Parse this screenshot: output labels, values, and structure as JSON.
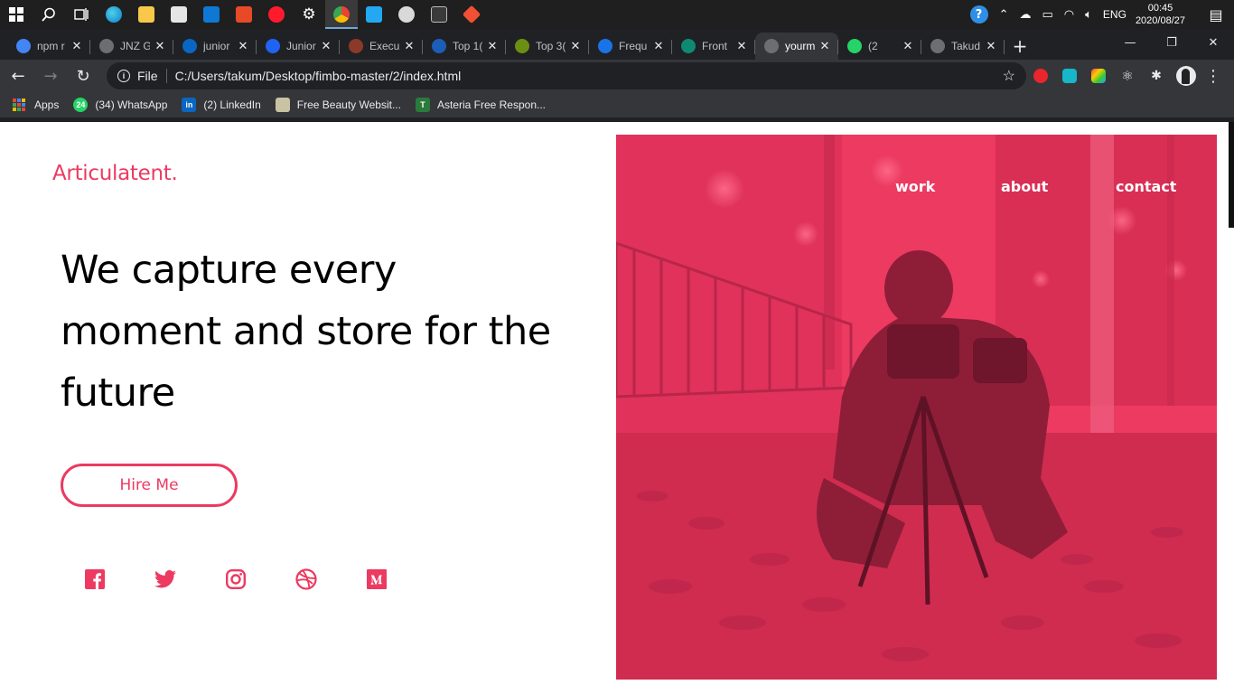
{
  "taskbar": {
    "clock_time": "00:45",
    "clock_date": "2020/08/27",
    "language": "ENG",
    "apps": [
      "windows-start",
      "search",
      "task-view",
      "edge",
      "file-explorer",
      "store",
      "mail",
      "office",
      "opera",
      "settings",
      "chrome",
      "vscode",
      "media",
      "terminal",
      "git"
    ]
  },
  "tabs": [
    {
      "label": "npm r",
      "favicon": "google-icon",
      "color": "#4285f4",
      "active": false
    },
    {
      "label": "JNZ G",
      "favicon": "globe-icon",
      "color": "#6b6e73",
      "active": false
    },
    {
      "label": "junior",
      "favicon": "linkedin-icon",
      "color": "#0a66c2",
      "active": false
    },
    {
      "label": "Junior",
      "favicon": "indeed-icon",
      "color": "#2164f3",
      "active": false
    },
    {
      "label": "Execu",
      "favicon": "x-icon",
      "color": "#8b3a2a",
      "active": false
    },
    {
      "label": "Top 1(",
      "favicon": "e-icon",
      "color": "#1c5db8",
      "active": false
    },
    {
      "label": "Top 3(",
      "favicon": "a-icon",
      "color": "#6a8f12",
      "active": false
    },
    {
      "label": "Frequ",
      "favicon": "ssd-icon",
      "color": "#1a73e8",
      "active": false
    },
    {
      "label": "Front",
      "favicon": "w-icon",
      "color": "#0e8a72",
      "active": false
    },
    {
      "label": "yourm",
      "favicon": "globe-icon",
      "color": "#6b6e73",
      "active": true
    },
    {
      "label": "(2",
      "favicon": "whatsapp-icon",
      "color": "#25d366",
      "active": false
    },
    {
      "label": "Takud",
      "favicon": "globe-icon",
      "color": "#6b6e73",
      "active": false
    }
  ],
  "addressbar": {
    "scheme_label": "File",
    "url": "C:/Users/takum/Desktop/fimbo-master/2/index.html"
  },
  "bookmarks": [
    {
      "label": "Apps",
      "icon": "apps-grid-icon"
    },
    {
      "label": "(34) WhatsApp",
      "icon": "whatsapp-icon"
    },
    {
      "label": "(2) LinkedIn",
      "icon": "linkedin-icon"
    },
    {
      "label": "Free Beauty Websit...",
      "icon": "website-icon"
    },
    {
      "label": "Asteria Free Respon...",
      "icon": "t-icon"
    }
  ],
  "page": {
    "brand": "Articulatent.",
    "headline": "We capture every moment and store for the future",
    "cta": "Hire Me",
    "nav": {
      "work": "work",
      "about": "about",
      "contact": "contact"
    },
    "socials": [
      "facebook-icon",
      "twitter-icon",
      "instagram-icon",
      "dribbble-icon",
      "medium-icon"
    ],
    "accent_color": "#ec3a61"
  }
}
